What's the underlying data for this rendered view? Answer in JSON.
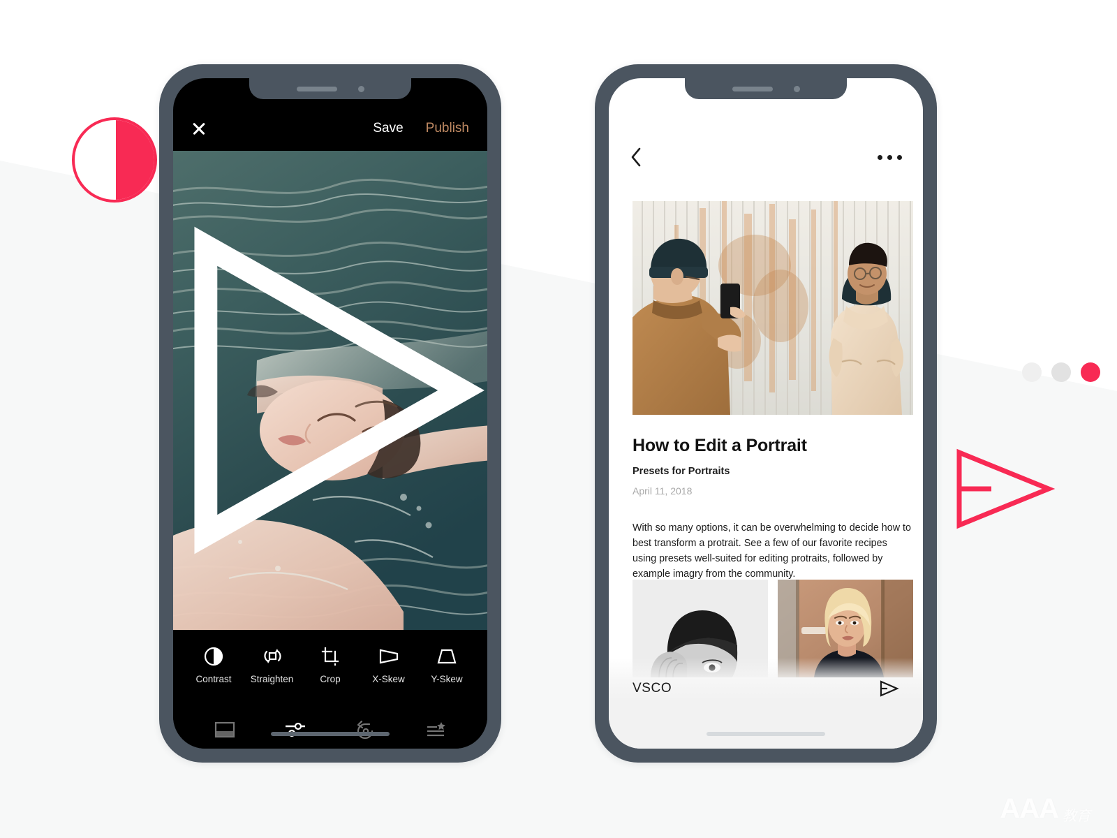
{
  "scene": {
    "background_color": "#FFFFFF",
    "band_color": "#F7F8F8",
    "accent_color": "#F82A54",
    "phone_frame_color": "#4B5560"
  },
  "decorations": {
    "contrast_circle_name": "contrast",
    "send_arrow_name": "publish",
    "dots": [
      {
        "color": "#EFEFEF"
      },
      {
        "color": "#E2E2E2"
      },
      {
        "color": "#F82A54"
      }
    ]
  },
  "watermark": {
    "main": "AAA",
    "sub": "教育"
  },
  "editor_screen": {
    "topbar": {
      "close_icon": "close-icon",
      "save_label": "Save",
      "publish_label": "Publish",
      "publish_color": "#C08A63"
    },
    "media": {
      "type": "video",
      "play_icon": "play-icon",
      "description": "person floating on back in teal water"
    },
    "tools": [
      {
        "label": "Contrast",
        "icon": "contrast-icon"
      },
      {
        "label": "Straighten",
        "icon": "straighten-icon"
      },
      {
        "label": "Crop",
        "icon": "crop-icon"
      },
      {
        "label": "X-Skew",
        "icon": "x-skew-icon"
      },
      {
        "label": "Y-Skew",
        "icon": "y-skew-icon"
      }
    ],
    "nav": [
      {
        "name": "presets",
        "icon": "presets-icon",
        "active": false
      },
      {
        "name": "adjust",
        "icon": "adjust-sliders-icon",
        "active": true
      },
      {
        "name": "revert",
        "icon": "undo-icon",
        "active": false
      },
      {
        "name": "recipes",
        "icon": "recipes-star-icon",
        "active": false
      }
    ]
  },
  "article_screen": {
    "topbar": {
      "back_icon": "back-chevron-icon",
      "more_icon": "more-dots-icon"
    },
    "hero": {
      "description": "two people photographing in front of a rusted corrugated wall"
    },
    "title": "How to Edit a Portrait",
    "subtitle": "Presets for Portraits",
    "date": "April 11, 2018",
    "body": "With so many options, it can be overwhelming to decide how to best transform a protrait. See a few of our favorite recipes using presets well-suited for editing protraits, followed by example imagry from the community.",
    "thumbnails": [
      {
        "description": "black and white portrait, hand on forehead"
      },
      {
        "description": "warm toned portrait, blonde bob hair"
      }
    ],
    "footer": {
      "brand": "VSCO",
      "send_icon": "send-icon"
    }
  }
}
